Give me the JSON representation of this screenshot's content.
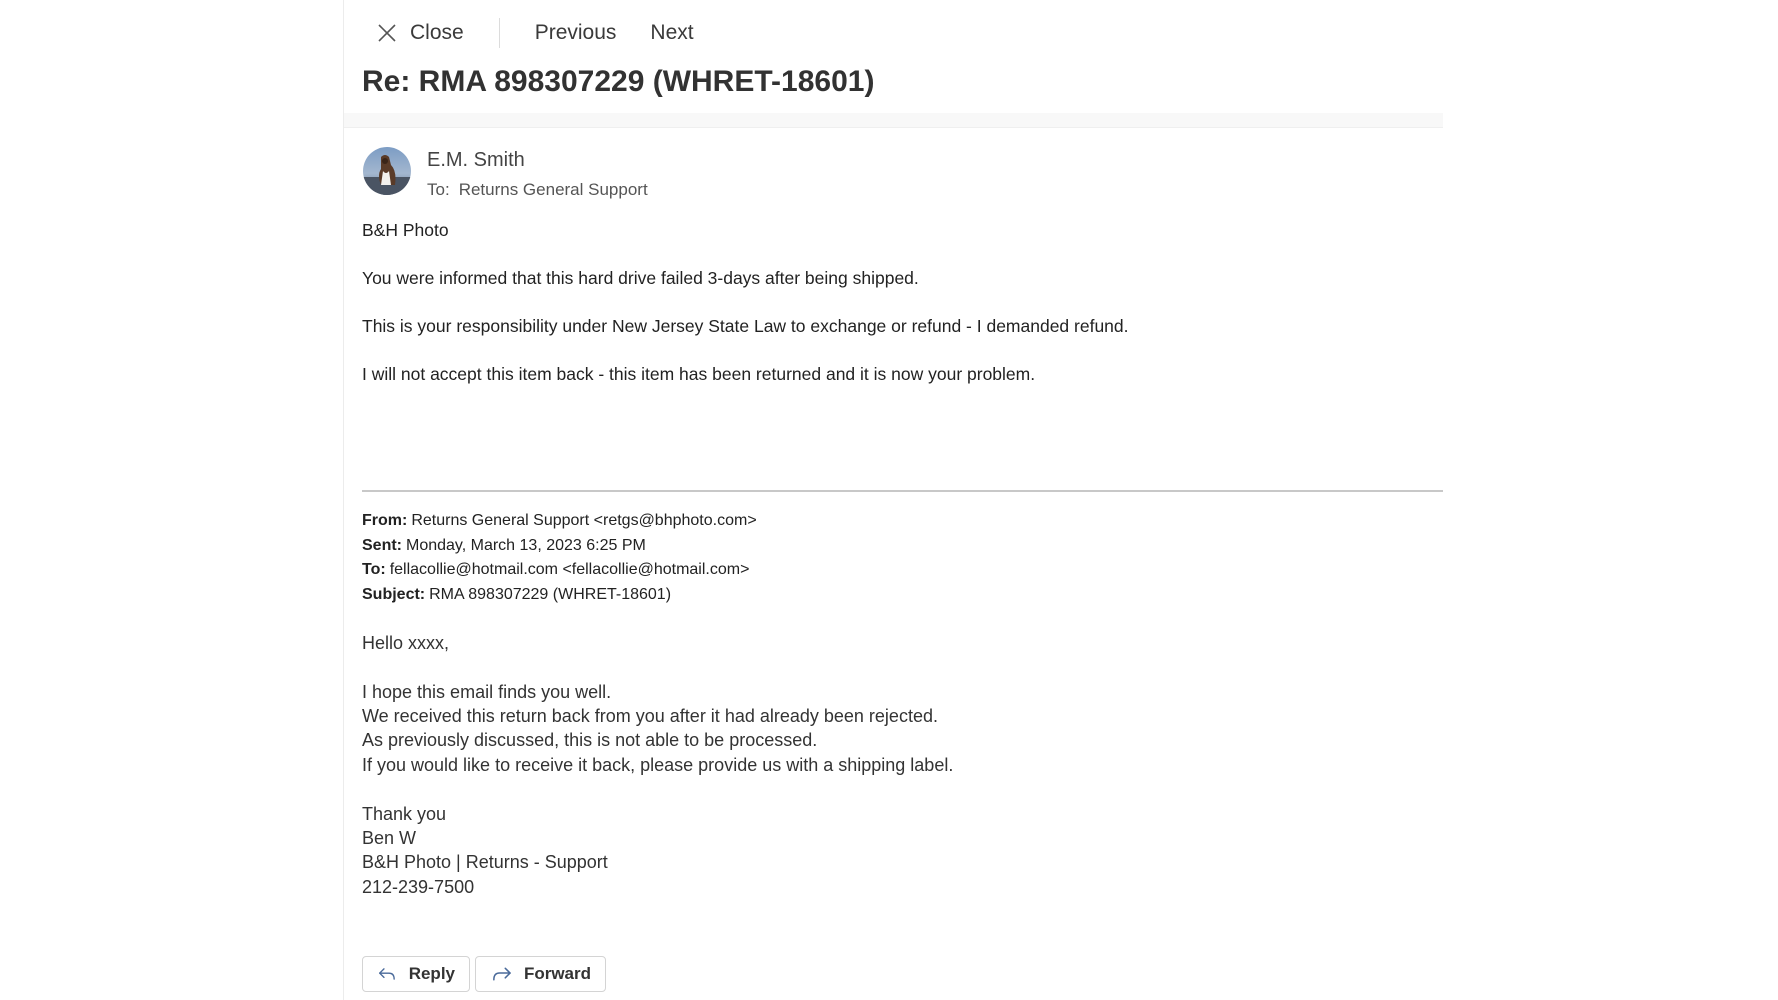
{
  "toolbar": {
    "close_label": "Close",
    "previous_label": "Previous",
    "next_label": "Next"
  },
  "email": {
    "subject": "Re: RMA 898307229 (WHRET-18601)",
    "sender": "E.M. Smith",
    "to_label": "To:",
    "to_value": "Returns General Support",
    "body": [
      "B&H Photo",
      "You were informed that this hard drive failed 3-days after being shipped.",
      "This is your responsibility under New Jersey State Law to exchange or refund - I demanded refund.",
      "I will not accept this item back - this item has been returned and it is now your problem."
    ]
  },
  "quoted": {
    "from_label": "From:",
    "from_value": "Returns General Support <retgs@bhphoto.com>",
    "sent_label": "Sent:",
    "sent_value": "Monday, March 13, 2023 6:25 PM",
    "to_label": "To:",
    "to_value": "fellacollie@hotmail.com <fellacollie@hotmail.com>",
    "subject_label": "Subject:",
    "subject_value": "RMA 898307229 (WHRET-18601)",
    "lines": [
      "Hello xxxx,",
      "I hope this email finds you well.",
      "We received this return back from you after it had already been rejected.",
      "As previously discussed, this is not able to be processed.",
      "If you would like to receive it back, please provide us with a shipping label.",
      "Thank you",
      "Ben W",
      "B&H Photo | Returns - Support",
      "212-239-7500"
    ]
  },
  "actions": {
    "reply_label": "Reply",
    "forward_label": "Forward"
  },
  "colors": {
    "text": "#222222",
    "divider": "#c8c8c8",
    "border": "#d4d4d4"
  },
  "icons": [
    "close-icon",
    "reply-icon",
    "forward-icon"
  ]
}
